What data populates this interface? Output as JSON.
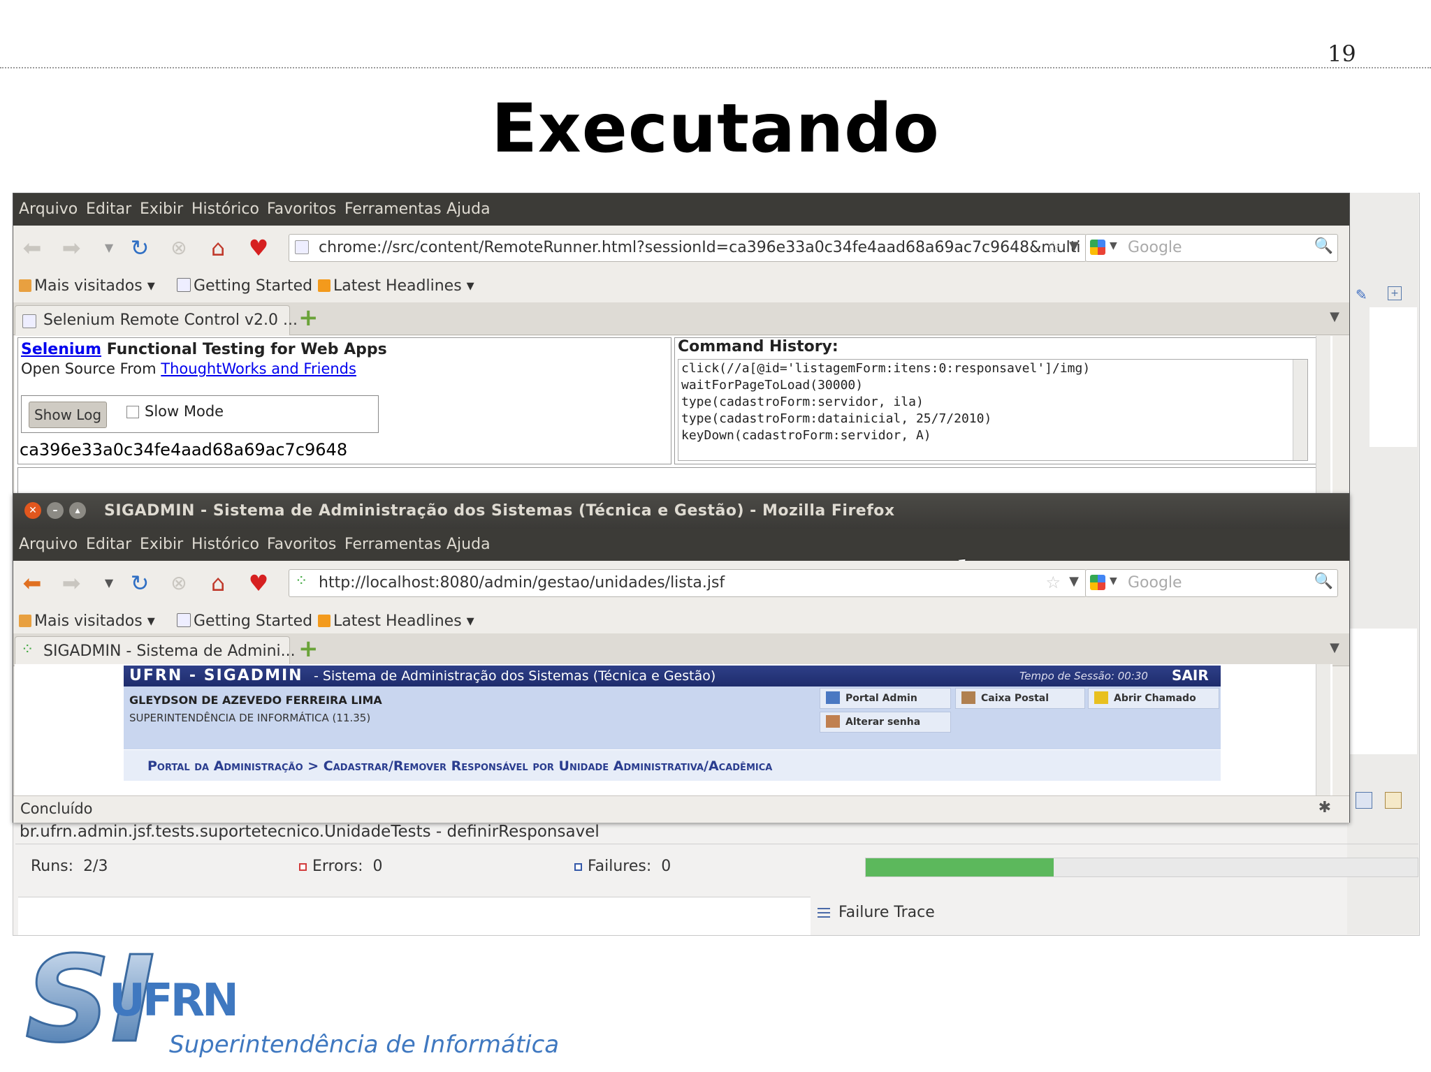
{
  "slide": {
    "number": "19",
    "title": "Executando"
  },
  "eclipse": {
    "test_name": "br.ufrn.admin.jsf.tests.suportetecnico.UnidadeTests - definirResponsavel",
    "runs_label": "Runs:",
    "runs_value": "2/3",
    "errors_label": "Errors:",
    "errors_value": "0",
    "failures_label": "Failures:",
    "failures_value": "0",
    "progress_fraction": 0.34,
    "failure_trace_label": "Failure Trace",
    "progress_color": "#5cb85c"
  },
  "firefox_menu": [
    "Arquivo",
    "Editar",
    "Exibir",
    "Histórico",
    "Favoritos",
    "Ferramentas",
    "Ajuda"
  ],
  "bookmarks": {
    "mais_visitados": "Mais visitados",
    "getting_started": "Getting Started",
    "latest_headlines": "Latest Headlines"
  },
  "search": {
    "placeholder": "Google"
  },
  "window1": {
    "url": "chrome://src/content/RemoteRunner.html?sessionId=ca396e33a0c34fe4aad68a69ac7c9648&multi",
    "tab_title": "Selenium Remote Control v2.0 ...",
    "selenium_link": "Selenium",
    "heading_rest": "Functional Testing for Web Apps",
    "open_source_from": "Open Source From",
    "thoughtworks_link": "ThoughtWorks and Friends",
    "show_log": "Show Log",
    "slow_mode": "Slow Mode",
    "session_id": "ca396e33a0c34fe4aad68a69ac7c9648",
    "command_history_title": "Command History:",
    "commands": [
      "click(//a[@id='listagemForm:itens:0:responsavel']/img)",
      "waitForPageToLoad(30000)",
      "type(cadastroForm:servidor, ila)",
      "type(cadastroForm:datainicial, 25/7/2010)",
      "keyDown(cadastroForm:servidor, A)"
    ]
  },
  "window2": {
    "title": "SIGADMIN - Sistema de Administração dos Sistemas (Técnica e Gestão) - Mozilla Firefox",
    "url": "http://localhost:8080/admin/gestao/unidades/lista.jsf",
    "tab_title": "SIGADMIN - Sistema de Admini...",
    "status": "Concluído",
    "page": {
      "brand": "UFRN - SIGADMIN",
      "system": "- Sistema de Administração dos Sistemas (Técnica e Gestão)",
      "session_time": "Tempo de Sessão: 00:30",
      "logout": "SAIR",
      "user_name": "GLEYDSON DE AZEVEDO FERREIRA LIMA",
      "user_dept": "SUPERINTENDÊNCIA DE INFORMÁTICA (11.35)",
      "portal_admin": "Portal Admin",
      "caixa_postal": "Caixa Postal",
      "abrir_chamado": "Abrir Chamado",
      "alterar_senha": "Alterar senha",
      "breadcrumb": "Portal da Administração > Cadastrar/Remover Responsável por Unidade Administrativa/Acadêmica"
    }
  },
  "logo": {
    "mark": "SI",
    "mark_sub": "UFRN",
    "text": "Superintendência de Informática"
  }
}
